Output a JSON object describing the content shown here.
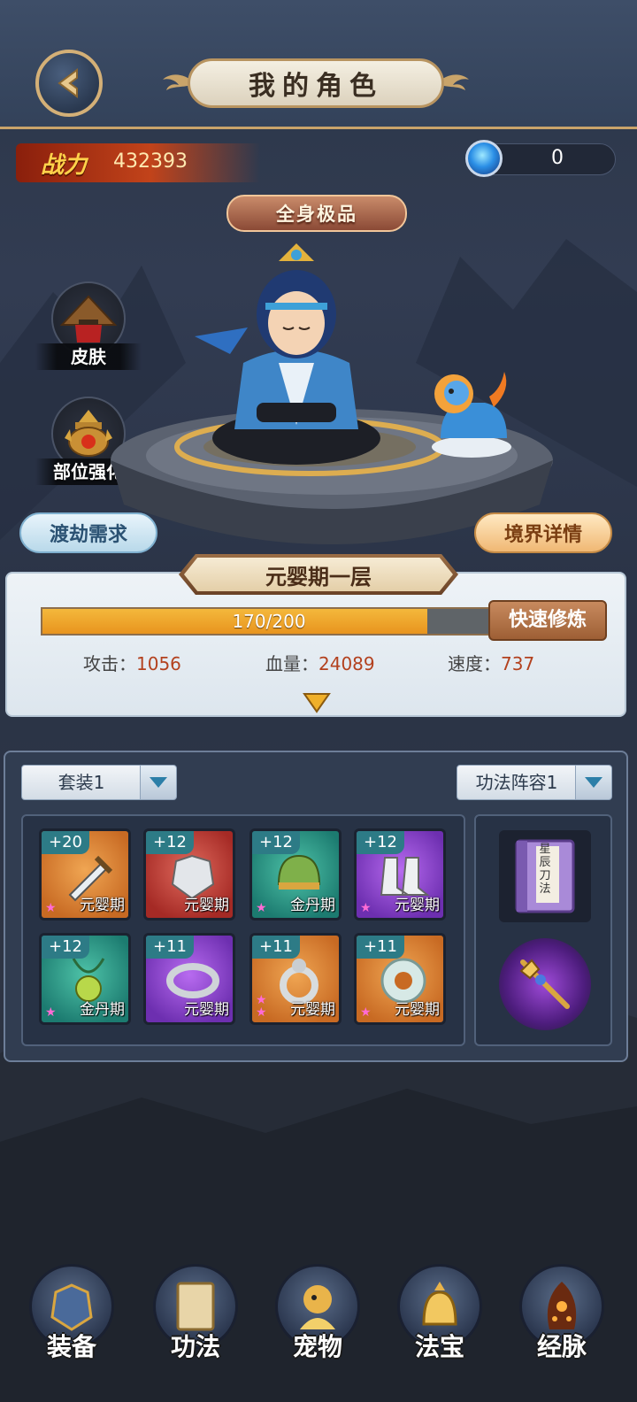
{
  "header": {
    "title": "我的角色"
  },
  "power": {
    "label": "战力",
    "value": "432393"
  },
  "currency": {
    "value": "0"
  },
  "side_buttons": {
    "skin": "皮肤",
    "part_enhance": "部位强化"
  },
  "quality_badge": "全身极品",
  "actions": {
    "tribulation": "渡劫需求",
    "realm_detail": "境界详情"
  },
  "realm": {
    "name": "元婴期一层",
    "exp_text": "170/200",
    "exp_fraction": 0.85,
    "quick_train": "快速修炼",
    "stats": [
      {
        "label": "攻击：",
        "value": "1056"
      },
      {
        "label": "血量：",
        "value": "24089"
      },
      {
        "label": "速度：",
        "value": "737"
      }
    ]
  },
  "equipment": {
    "set_select": "套装1",
    "skill_select": "功法阵容1",
    "slots": [
      {
        "level": "+20",
        "realm": "元婴期",
        "color": "orange",
        "stars": 1,
        "icon": "sword-icon"
      },
      {
        "level": "+12",
        "realm": "元婴期",
        "color": "red",
        "stars": 0,
        "icon": "armor-icon"
      },
      {
        "level": "+12",
        "realm": "金丹期",
        "color": "green",
        "stars": 1,
        "icon": "helmet-icon"
      },
      {
        "level": "+12",
        "realm": "元婴期",
        "color": "purple",
        "stars": 1,
        "icon": "boots-icon"
      },
      {
        "level": "+12",
        "realm": "金丹期",
        "color": "green",
        "stars": 1,
        "icon": "amulet-icon"
      },
      {
        "level": "+11",
        "realm": "元婴期",
        "color": "purple",
        "stars": 0,
        "icon": "bracelet-icon"
      },
      {
        "level": "+11",
        "realm": "元婴期",
        "color": "orange",
        "stars": 2,
        "icon": "ring-icon"
      },
      {
        "level": "+11",
        "realm": "元婴期",
        "color": "orange",
        "stars": 1,
        "icon": "jade-disc-icon"
      }
    ],
    "skill_book_title": "星辰刀法"
  },
  "nav": [
    {
      "label": "装备",
      "icon": "armor-icon"
    },
    {
      "label": "功法",
      "icon": "scroll-book-icon"
    },
    {
      "label": "宠物",
      "icon": "pet-icon"
    },
    {
      "label": "法宝",
      "icon": "treasure-bell-icon"
    },
    {
      "label": "经脉",
      "icon": "meridian-icon"
    }
  ]
}
